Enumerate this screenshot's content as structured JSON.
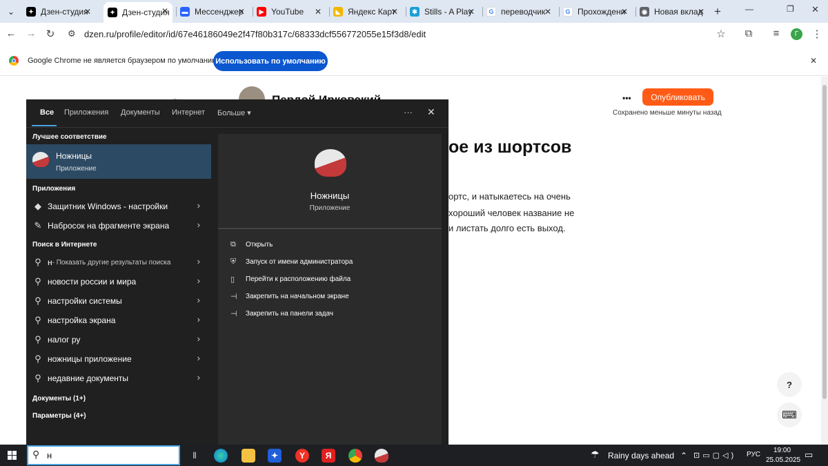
{
  "tabs": [
    {
      "label": "Дзен-студия",
      "close": "✕",
      "icon_color": "#000000",
      "icon_glyph": "✦"
    },
    {
      "label": "Дзен-студия",
      "close": "✕",
      "icon_color": "#000000",
      "icon_glyph": "✦"
    },
    {
      "label": "Мессенджер",
      "close": "✕",
      "icon_color": "#2962ff",
      "icon_glyph": "▬"
    },
    {
      "label": "YouTube",
      "close": "✕",
      "icon_color": "#ff0000",
      "icon_glyph": "▶"
    },
    {
      "label": "Яндекс Карт",
      "close": "✕",
      "icon_color": "#f2b600",
      "icon_glyph": "◣"
    },
    {
      "label": "Stills - A Play",
      "close": "✕",
      "icon_color": "#1a9fd8",
      "icon_glyph": "✱"
    },
    {
      "label": "переводчик",
      "close": "✕",
      "icon_color": "#ffffff",
      "icon_glyph": "G"
    },
    {
      "label": "Прохождени",
      "close": "✕",
      "icon_color": "#ffffff",
      "icon_glyph": "G"
    },
    {
      "label": "Новая вклад",
      "close": "✕",
      "icon_color": "#5f6368",
      "icon_glyph": "◉"
    }
  ],
  "tabbar": {
    "new_tab": "+",
    "menu": "⌄",
    "minimize": "—",
    "restore": "❐",
    "close": "✕"
  },
  "toolbar": {
    "back": "←",
    "forward": "→",
    "reload": "↻",
    "site_info": "⚙",
    "url": "dzen.ru/profile/editor/id/67e46186049e2f47f80b317c/68333dcf556772055e15f3d8/edit",
    "star": "☆",
    "extensions": "⧉",
    "media": "≡",
    "avatar": "Г",
    "more": "⋮"
  },
  "infobar": {
    "text": "Google Chrome не является браузером по умолчанию.",
    "button": "Использовать по умолчанию",
    "close": "✕"
  },
  "page": {
    "back_arrow": "←",
    "author": "Пердой Ирковский",
    "dots": "•••",
    "publish": "Опубликовать",
    "saved": "Сохранено меньше минуты назад",
    "title_fragment": "ое из шортсов",
    "body_line1": "ортс, и натыкаетесь на очень",
    "body_line2": "хороший человек название не",
    "body_line3": "и листать долго есть выход.",
    "help": "?",
    "chat": "⌨"
  },
  "search": {
    "filters": [
      "Все",
      "Приложения",
      "Документы",
      "Интернет",
      "Больше ▾"
    ],
    "more_dots": "···",
    "close": "✕",
    "best_match_header": "Лучшее соответствие",
    "best_match_title": "Ножницы",
    "best_match_sub": "Приложение",
    "apps_header": "Приложения",
    "apps": [
      {
        "label": "Защитник Windows - настройки",
        "icon": "◆"
      },
      {
        "label": "Набросок на фрагменте экрана",
        "icon": "✎"
      }
    ],
    "web_header": "Поиск в Интернете",
    "web": [
      {
        "label": "н",
        "suffix": " - Показать другие результаты поиска"
      },
      {
        "label": "новости россии и мира",
        "suffix": ""
      },
      {
        "label": "настройки системы",
        "suffix": ""
      },
      {
        "label": "настройка экрана",
        "suffix": ""
      },
      {
        "label": "налог ру",
        "suffix": ""
      },
      {
        "label": "ножницы приложение",
        "suffix": ""
      },
      {
        "label": "недавние документы",
        "suffix": ""
      }
    ],
    "docs": "Документы (1+)",
    "params": "Параметры (4+)",
    "preview_title": "Ножницы",
    "preview_sub": "Приложение",
    "actions": [
      {
        "label": "Открыть",
        "icon": "⧉"
      },
      {
        "label": "Запуск от имени администратора",
        "icon": "⛨"
      },
      {
        "label": "Перейти к расположению файла",
        "icon": "▯"
      },
      {
        "label": "Закрепить на начальном экране",
        "icon": "⊣"
      },
      {
        "label": "Закрепить на панели задач",
        "icon": "⊣"
      }
    ],
    "query": "н"
  },
  "taskbar": {
    "weather": "Rainy days ahead",
    "lang": "РУС",
    "time": "19:00",
    "date": "25.05.2025",
    "notify": "▭"
  }
}
